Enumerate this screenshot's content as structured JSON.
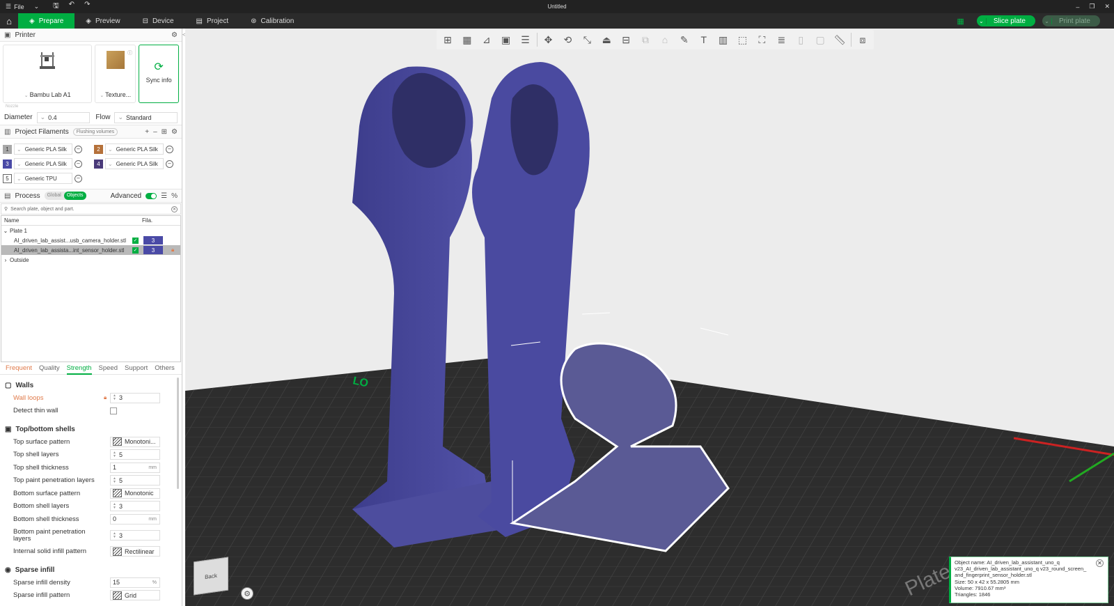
{
  "titlebar": {
    "file_label": "File",
    "title": "Untitled"
  },
  "topbar": {
    "tabs": [
      {
        "label": "Prepare"
      },
      {
        "label": "Preview"
      },
      {
        "label": "Device"
      },
      {
        "label": "Project"
      },
      {
        "label": "Calibration"
      }
    ],
    "slice_label": "Slice plate",
    "print_label": "Print plate"
  },
  "printer": {
    "section_title": "Printer",
    "printer_name": "Bambu Lab A1",
    "plate_type": "Texture...",
    "sync_label": "Sync info",
    "nozzle_hint": "Nozzle",
    "diameter_label": "Diameter",
    "diameter_value": "0.4",
    "flow_label": "Flow",
    "flow_value": "Standard"
  },
  "filaments": {
    "section_title": "Project Filaments",
    "flushing_label": "Flushing volumes",
    "items": [
      {
        "num": "1",
        "name": "Generic PLA Silk",
        "color": "#a8a8a8"
      },
      {
        "num": "2",
        "name": "Generic PLA Silk",
        "color": "#b5713a"
      },
      {
        "num": "3",
        "name": "Generic PLA Silk",
        "color": "#4a4aa6"
      },
      {
        "num": "4",
        "name": "Generic PLA Silk",
        "color": "#4a3a7a"
      },
      {
        "num": "5",
        "name": "Generic TPU",
        "color": "#ffffff"
      }
    ]
  },
  "process": {
    "section_title": "Process",
    "global_label": "Global",
    "objects_label": "Objects",
    "advanced_label": "Advanced",
    "advanced_on": true,
    "search_placeholder": "Search plate, object and part."
  },
  "tree": {
    "col_name": "Name",
    "col_fila": "Fila.",
    "plate_label": "Plate 1",
    "objects": [
      {
        "name": "AI_driven_lab_assist...usb_camera_holder.stl",
        "fila": "3"
      },
      {
        "name": "AI_driven_lab_assista...int_sensor_holder.stl",
        "fila": "3"
      }
    ],
    "outside_label": "Outside"
  },
  "settings_tabs": [
    "Frequent",
    "Quality",
    "Strength",
    "Speed",
    "Support",
    "Others"
  ],
  "walls": {
    "title": "Walls",
    "wall_loops_label": "Wall loops",
    "wall_loops": "3",
    "detect_thin_wall_label": "Detect thin wall"
  },
  "shells": {
    "title": "Top/bottom shells",
    "top_surface_pattern_label": "Top surface pattern",
    "top_surface_pattern": "Monotoni...",
    "top_shell_layers_label": "Top shell layers",
    "top_shell_layers": "5",
    "top_shell_thickness_label": "Top shell thickness",
    "top_shell_thickness": "1",
    "top_paint_label": "Top paint penetration layers",
    "top_paint": "5",
    "bottom_surface_pattern_label": "Bottom surface pattern",
    "bottom_surface_pattern": "Monotonic",
    "bottom_shell_layers_label": "Bottom shell layers",
    "bottom_shell_layers": "3",
    "bottom_shell_thickness_label": "Bottom shell thickness",
    "bottom_shell_thickness": "0",
    "bottom_paint_label": "Bottom paint penetration layers",
    "bottom_paint": "3",
    "internal_solid_label": "Internal solid infill pattern",
    "internal_solid": "Rectilinear",
    "unit": "mm"
  },
  "sparse": {
    "title": "Sparse infill",
    "density_label": "Sparse infill density",
    "density": "15",
    "density_unit": "%",
    "pattern_label": "Sparse infill pattern",
    "pattern": "Grid"
  },
  "viewport": {
    "cube_label": "Back",
    "plate_text": "Plate"
  },
  "info": {
    "line1": "Object name: AI_driven_lab_assistant_uno_q",
    "line2": "v23_AI_driven_lab_assistant_uno_q v23_round_screen_",
    "line3": "and_fingerprint_sensor_holder.stl",
    "size": "Size: 50 x 42 x 55.2805 mm",
    "volume": "Volume: 7910.67 mm³",
    "triangles": "Triangles: 1846"
  },
  "colors": {
    "accent": "#00ae42",
    "model": "#4a4aa6",
    "bed": "#2d2d2d"
  }
}
